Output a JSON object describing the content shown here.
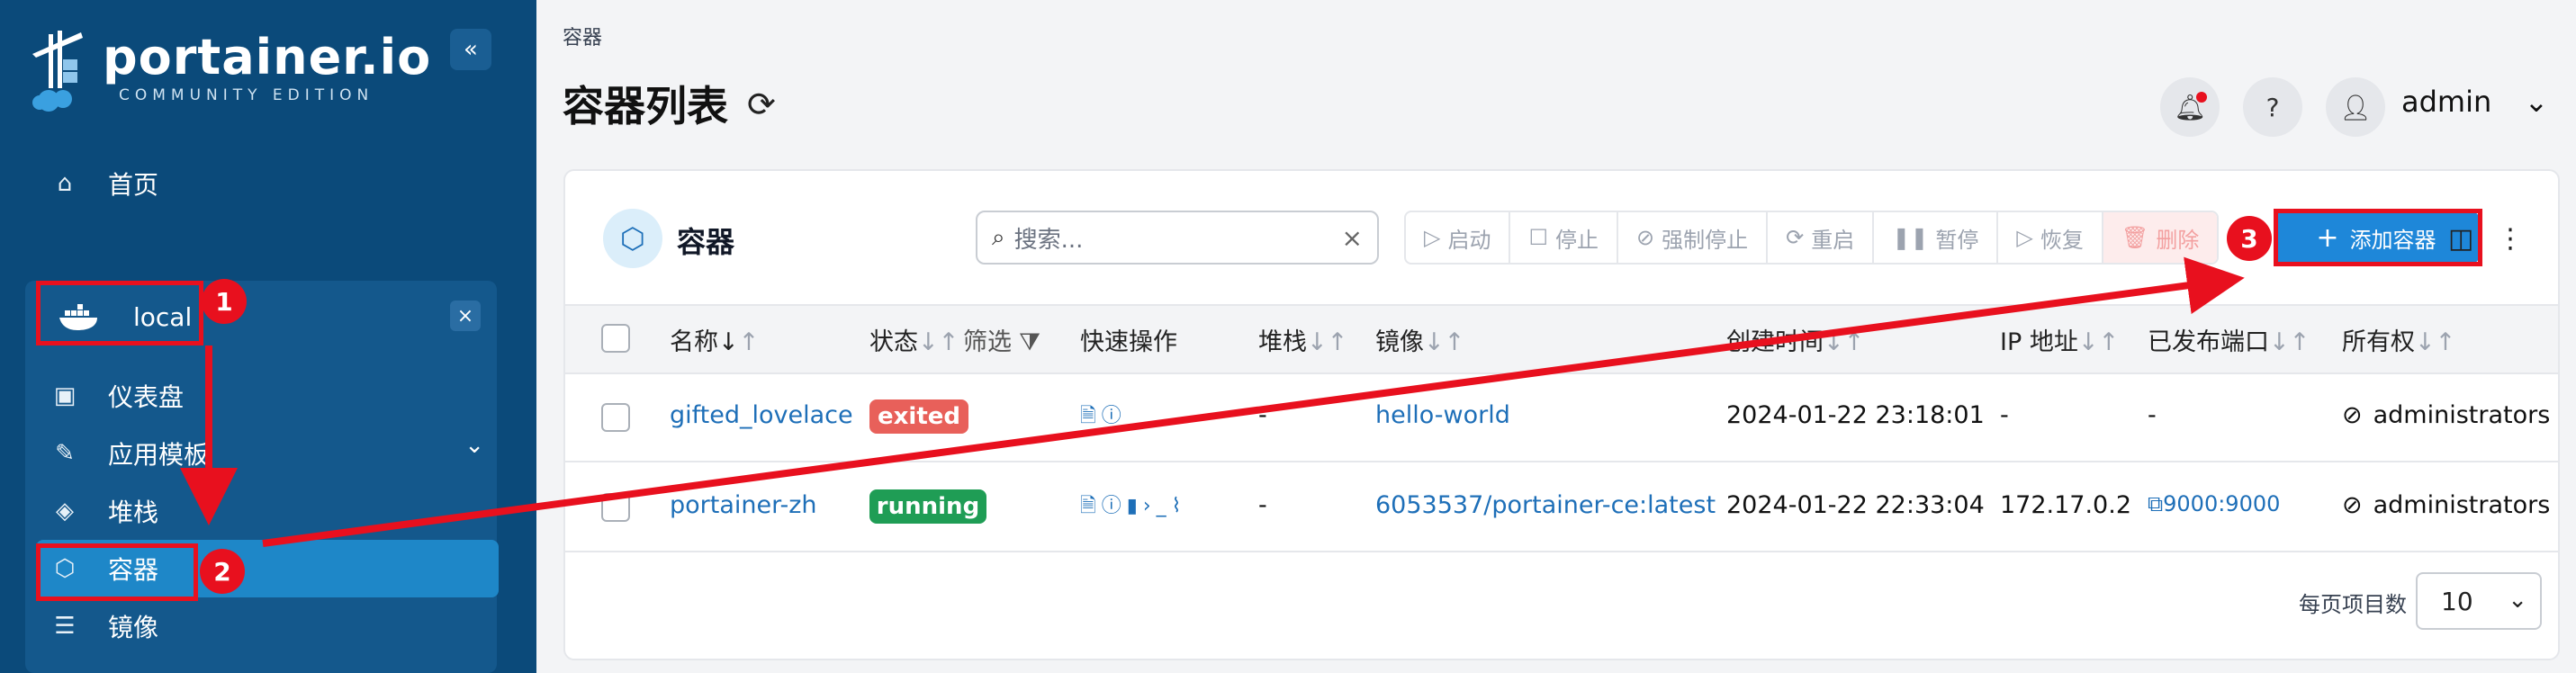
{
  "sidebar": {
    "logo_text": "portainer.io",
    "logo_subtitle": "COMMUNITY EDITION",
    "collapse_icon": "«",
    "home_label": "首页",
    "environment": {
      "name": "local",
      "close_icon": "×"
    },
    "items": [
      {
        "label": "仪表盘"
      },
      {
        "label": "应用模板"
      },
      {
        "label": "堆栈"
      },
      {
        "label": "容器"
      },
      {
        "label": "镜像"
      }
    ]
  },
  "header": {
    "breadcrumb": "容器",
    "title": "容器列表",
    "user": "admin"
  },
  "card": {
    "title": "容器",
    "search_placeholder": "搜索...",
    "toolbar": [
      "启动",
      "停止",
      "强制停止",
      "重启",
      "暂停",
      "恢复",
      "删除"
    ],
    "add_button": "添加容器"
  },
  "table": {
    "columns": [
      "名称",
      "状态",
      "筛选",
      "快速操作",
      "堆栈",
      "镜像",
      "创建时间",
      "IP 地址",
      "已发布端口",
      "所有权"
    ],
    "rows": [
      {
        "name": "gifted_lovelace",
        "status": "exited",
        "stack": "-",
        "image": "hello-world",
        "created": "2024-01-22 23:18:01",
        "ip": "-",
        "ports": "-",
        "ownership": "administrators"
      },
      {
        "name": "portainer-zh",
        "status": "running",
        "stack": "-",
        "image": "6053537/portainer-ce:latest",
        "created": "2024-01-22 22:33:04",
        "ip": "172.17.0.2",
        "ports": "9000:9000",
        "ownership": "administrators"
      }
    ],
    "per_page_label": "每页项目数",
    "per_page_value": "10"
  },
  "annotations": [
    "1",
    "2",
    "3"
  ],
  "colors": {
    "sidebar": "#0b4a7a",
    "accent": "#1e87d9",
    "exited": "#e8605a",
    "running": "#1f9d55",
    "annotation": "#e8101e"
  }
}
